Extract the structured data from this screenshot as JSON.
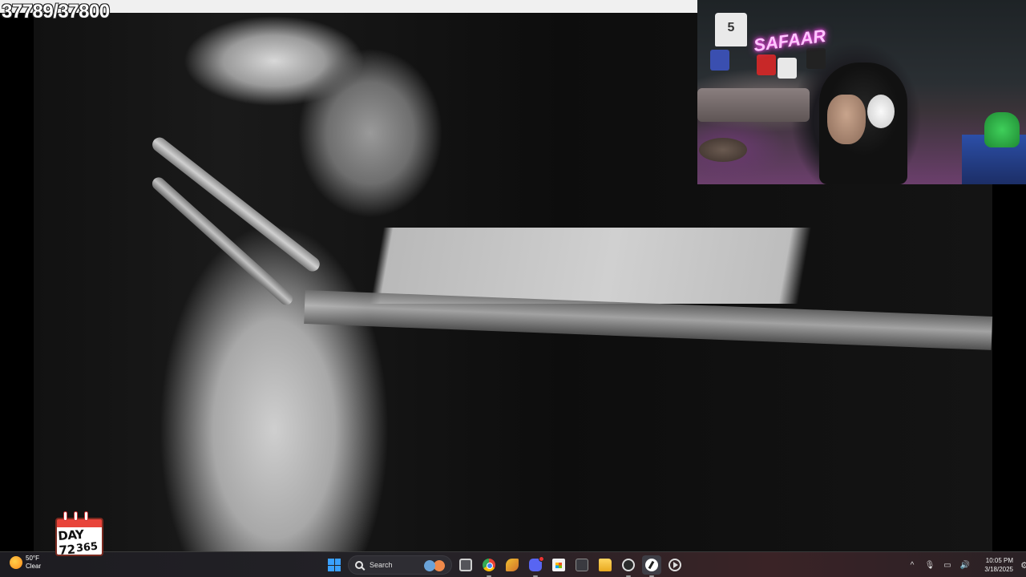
{
  "overlay": {
    "counter": "37789/37800"
  },
  "webcam": {
    "neon_sign": "SAFAAR",
    "jersey_number": "5"
  },
  "day_tracker": {
    "day": "DAY 72",
    "total": "365"
  },
  "weather": {
    "temperature": "50°F",
    "condition": "Clear"
  },
  "taskbar": {
    "search_label": "Search",
    "tray": {
      "chevron": "^",
      "mic": "🎙",
      "network": "▭",
      "volume": "🔊"
    },
    "clock": {
      "time": "10:05 PM",
      "date": "3/18/2025"
    },
    "notification_icon": "⚙"
  },
  "colors": {
    "taskbar_bg": "#1d1c21",
    "windows_accent": "#3aa0ff",
    "neon_pink": "#ff4df2"
  }
}
